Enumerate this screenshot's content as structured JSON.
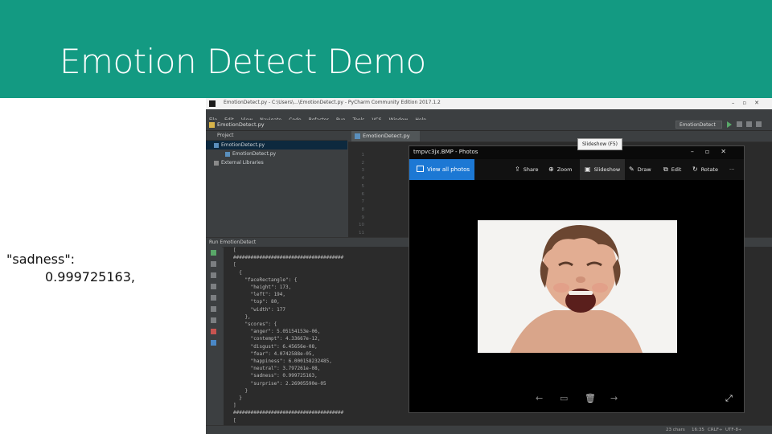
{
  "slide": {
    "title": "Emotion Detect Demo",
    "note_key": "\"sadness\":",
    "note_value": "0.999725163,"
  },
  "colors": {
    "banner": "#139a82",
    "ide_bg": "#3c3f41",
    "editor_bg": "#2b2b2b",
    "photos_accent": "#1c78d4"
  },
  "ide": {
    "window_title": "EmotionDetect.py - C:\\Users\\...\\EmotionDetect.py - PyCharm Community Edition 2017.1.2",
    "menu": [
      "File",
      "Edit",
      "View",
      "Navigate",
      "Code",
      "Refactor",
      "Run",
      "Tools",
      "VCS",
      "Window",
      "Help"
    ],
    "breadcrumb": "EmotionDetect.py",
    "run_config": "EmotionDetect",
    "project_panel_label": "Project",
    "tree": [
      {
        "label": "EmotionDetect.py",
        "icon": "python-file-icon"
      },
      {
        "label": "EmotionDetect.py",
        "icon": "python-file-icon"
      },
      {
        "label": "External Libraries",
        "icon": "library-icon"
      }
    ],
    "editor_tab": "EmotionDetect.py",
    "line_numbers": [
      "1",
      "2",
      "3",
      "4",
      "5",
      "6",
      "7",
      "8",
      "9",
      "10",
      "11"
    ],
    "run_panel_label": "Run EmotionDetect",
    "console_text": "[\n######################################\n[\n  {\n    \"faceRectangle\": {\n      \"height\": 173,\n      \"left\": 194,\n      \"top\": 80,\n      \"width\": 177\n    },\n    \"scores\": {\n      \"anger\": 5.05154153e-06,\n      \"contempt\": 4.33667e-12,\n      \"disgust\": 6.45656e-08,\n      \"fear\": 4.0742588e-05,\n      \"happiness\": 6.000158232485,\n      \"neutral\": 3.797261e-08,\n      \"sadness\": 0.999725163,\n      \"surprise\": 2.26905590e-05\n    }\n  }\n]\n######################################\n[\n  {\n    \"faceRectangle\": {",
    "status": {
      "chars": "23 chars",
      "pos": "16:35",
      "crlf": "CRLF÷",
      "enc": "UTF-8÷"
    }
  },
  "photos": {
    "title": "tmpvc3jx.BMP - Photos",
    "view_all": "View all photos",
    "toolbar": [
      {
        "label": "Share",
        "icon": "share-icon"
      },
      {
        "label": "Zoom",
        "icon": "zoom-icon"
      },
      {
        "label": "Slideshow",
        "icon": "slideshow-icon"
      },
      {
        "label": "Draw",
        "icon": "draw-icon"
      },
      {
        "label": "Edit",
        "icon": "edit-icon"
      },
      {
        "label": "Rotate",
        "icon": "rotate-icon"
      }
    ],
    "more": "···",
    "tooltip": "Slideshow (F5)"
  }
}
